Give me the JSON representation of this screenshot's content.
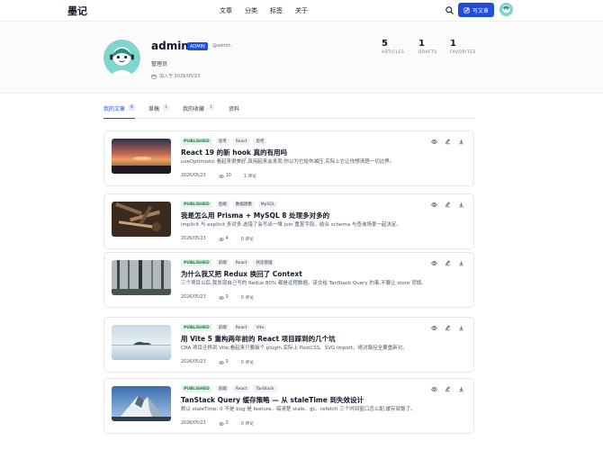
{
  "header": {
    "logo": "墨记",
    "nav": [
      "文章",
      "分类",
      "标签",
      "关于"
    ],
    "write_label": "写文章"
  },
  "profile": {
    "username": "admin",
    "role_badge": "ADMIN",
    "handle": "@admin",
    "role_label": "管理员",
    "joined": "加入于 2026/05/23",
    "stats": [
      {
        "value": "5",
        "label": "ARTICLES"
      },
      {
        "value": "1",
        "label": "DRAFTS"
      },
      {
        "value": "1",
        "label": "FAVORITES"
      }
    ]
  },
  "tabs": [
    {
      "label": "我的文章",
      "count": "6",
      "active": true
    },
    {
      "label": "草稿",
      "count": "1"
    },
    {
      "label": "我的收藏",
      "count": "1"
    },
    {
      "label": "资料",
      "count": ""
    }
  ],
  "articles": [
    {
      "status": "PUBLISHED",
      "tags": [
        "思考",
        "React",
        "思考"
      ],
      "title": "React 19 的新 hook 真的有用吗",
      "desc": "useOptimistic 看起来很美好,真用起来会发现:你以为它给你减压,实际上它让你想清楚一切边界。",
      "date": "2026/05/23",
      "views": "10",
      "comments": "1 评论",
      "thumb": "sunset"
    },
    {
      "status": "PUBLISHED",
      "tags": [
        "后端",
        "数据建模",
        "MySQL"
      ],
      "title": "我是怎么用 Prisma + MySQL 8 处理多对多的",
      "desc": "implicit 与 explicit 多对多,选错了会写出一堆 join 重复字段。结合 schema 与查询场景一起决定。",
      "date": "2026/05/23",
      "views": "4",
      "comments": "0 评论",
      "thumb": "tools"
    },
    {
      "status": "PUBLISHED",
      "tags": [
        "前端",
        "React",
        "状态管理"
      ],
      "title": "为什么我又把 Redux 换回了 Context",
      "desc": "三个项目以后,我发现自己写的 Redux 80% 都是远程数据。该交给 TanStack Query 的事,不要让 store 背锅。",
      "date": "2026/05/23",
      "views": "0",
      "comments": "0 评论",
      "thumb": "forest"
    },
    {
      "status": "PUBLISHED",
      "tags": [
        "前端",
        "React",
        "Vite"
      ],
      "title": "用 Vite 5 重构两年前的 React 项目踩到的几个坑",
      "desc": "CRA 项目迁移到 Vite,看起来只要装个 plugin,实际上 PostCSS、SVG import、绝对路径全要重新对。",
      "date": "2026/05/23",
      "views": "0",
      "comments": "0 评论",
      "thumb": "lake"
    },
    {
      "status": "PUBLISHED",
      "tags": [
        "前端",
        "React",
        "TanStack"
      ],
      "title": "TanStack Query 缓存策略 — 从 staleTime 到失效设计",
      "desc": "默认 staleTime: 0 不是 bug 是 feature。搞清楚 stale、gc、refetch 三个时间窗口怎么配,缓存就稳了。",
      "date": "2026/05/23",
      "views": "3",
      "comments": "0 评论",
      "thumb": "mountain"
    }
  ]
}
